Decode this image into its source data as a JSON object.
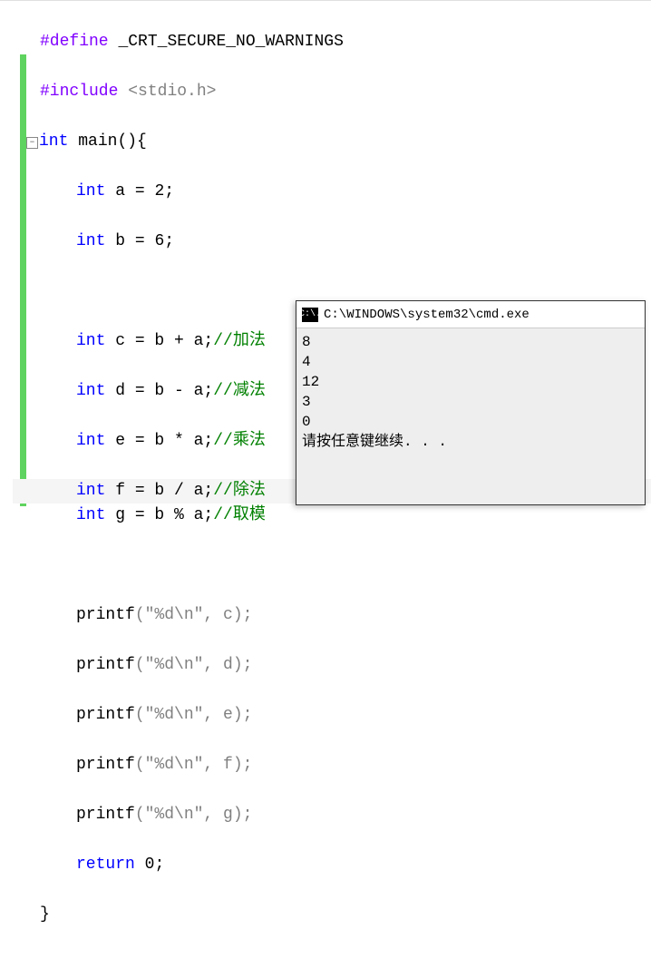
{
  "code": {
    "define": {
      "directive": "#define",
      "macro": "_CRT_SECURE_NO_WARNINGS"
    },
    "include": {
      "directive": "#include",
      "header": "<stdio.h>"
    },
    "main_decl": {
      "type": "int",
      "name": "main",
      "parens": "()",
      "brace": "{"
    },
    "decl_a": {
      "type": "int",
      "name": "a",
      "eq": "=",
      "val": "2",
      "semi": ";"
    },
    "decl_b": {
      "type": "int",
      "name": "b",
      "eq": "=",
      "val": "6",
      "semi": ";"
    },
    "decl_c": {
      "type": "int",
      "expr": "c = b + a;",
      "comment": "//加法"
    },
    "decl_d": {
      "type": "int",
      "expr": "d = b - a;",
      "comment": "//减法"
    },
    "decl_e": {
      "type": "int",
      "expr": "e = b * a;",
      "comment": "//乘法"
    },
    "decl_f": {
      "type": "int",
      "expr": "f = b / a;",
      "comment": "//除法"
    },
    "decl_g": {
      "type": "int",
      "expr": "g = b % a;",
      "comment": "//取模"
    },
    "printf_c": {
      "fn": "printf",
      "args": "(\"%d\\n\", c);"
    },
    "printf_d": {
      "fn": "printf",
      "args": "(\"%d\\n\", d);"
    },
    "printf_e": {
      "fn": "printf",
      "args": "(\"%d\\n\", e);"
    },
    "printf_f": {
      "fn": "printf",
      "args": "(\"%d\\n\", f);"
    },
    "printf_g": {
      "fn": "printf",
      "args": "(\"%d\\n\", g);"
    },
    "return": {
      "kw": "return",
      "val": "0",
      "semi": ";"
    },
    "close_brace": "}"
  },
  "fold_glyph": "−",
  "console": {
    "title": "C:\\WINDOWS\\system32\\cmd.exe",
    "icon_text": "C:\\.",
    "lines": [
      "8",
      "4",
      "12",
      "3",
      "0",
      "请按任意键继续. . ."
    ]
  }
}
